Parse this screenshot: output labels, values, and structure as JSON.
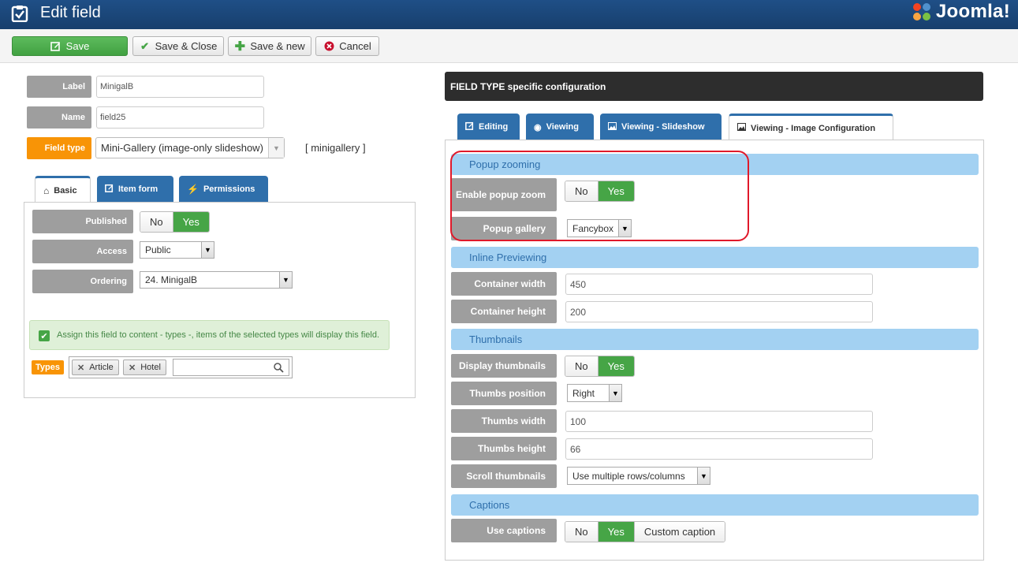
{
  "header": {
    "title": "Edit field",
    "logo_text": "Joomla!"
  },
  "toolbar": {
    "save": "Save",
    "save_close": "Save & Close",
    "save_new": "Save & new",
    "cancel": "Cancel"
  },
  "form": {
    "label_lbl": "Label",
    "label_val": "MinigalB",
    "name_lbl": "Name",
    "name_val": "field25",
    "type_lbl": "Field type",
    "type_val": "Mini-Gallery (image-only slideshow)",
    "type_code": "[ minigallery ]"
  },
  "left_tabs": [
    "Basic",
    "Item form",
    "Permissions"
  ],
  "basic": {
    "published_lbl": "Published",
    "no": "No",
    "yes": "Yes",
    "access_lbl": "Access",
    "access_val": "Public",
    "ordering_lbl": "Ordering",
    "ordering_val": "24. MinigalB",
    "notice": "Assign this field to content - types -, items of the selected types will display this field.",
    "types_lbl": "Types",
    "types": [
      "Article",
      "Hotel"
    ]
  },
  "right": {
    "bar_title": "FIELD TYPE specific configuration",
    "tabs": [
      "Editing",
      "Viewing",
      "Viewing - Slideshow",
      "Viewing - Image Configuration"
    ],
    "popup_section": "Popup zooming",
    "enable_popup_lbl": "Enable popup zoom",
    "popup_gallery_lbl": "Popup gallery",
    "popup_gallery_val": "Fancybox",
    "inline_section": "Inline Previewing",
    "cw_lbl": "Container width",
    "cw_val": "450",
    "ch_lbl": "Container height",
    "ch_val": "200",
    "thumbs_section": "Thumbnails",
    "disp_lbl": "Display thumbnails",
    "pos_lbl": "Thumbs position",
    "pos_val": "Right",
    "tw_lbl": "Thumbs width",
    "tw_val": "100",
    "th_lbl": "Thumbs height",
    "th_val": "66",
    "scroll_lbl": "Scroll thumbnails",
    "scroll_val": "Use multiple rows/columns",
    "captions_section": "Captions",
    "cap_lbl": "Use captions",
    "no": "No",
    "yes": "Yes",
    "custom": "Custom caption"
  },
  "colors": {
    "header": "#1f4f86",
    "tab": "#2f6fab",
    "green": "#46a546",
    "orange": "#f89406",
    "section": "#a3d1f2",
    "highlight": "#e0192a"
  }
}
